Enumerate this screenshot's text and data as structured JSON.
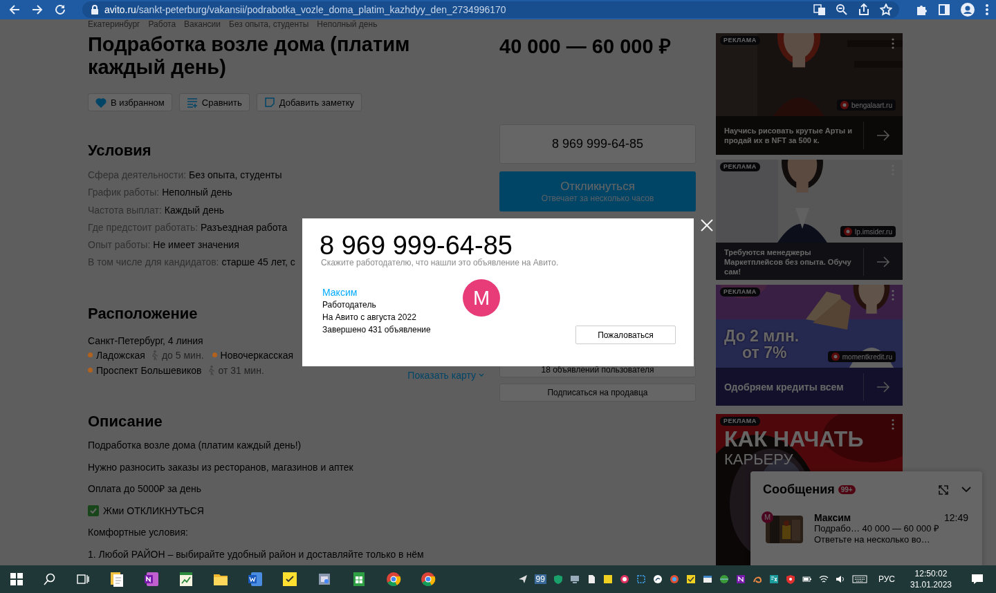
{
  "browser": {
    "url": "avito.ru/sankt-peterburg/vakansii/podrabotka_vozle_doma_platim_kazhdyy_den_2734996170"
  },
  "breadcrumbs": [
    "Екатеринбург",
    "Работа",
    "Вакансии",
    "Без опыта, студенты",
    "Неполный день"
  ],
  "title": "Подработка возле дома (платим каждый день)",
  "actions": [
    {
      "kind": "favorite",
      "label": "В избранном",
      "on": true
    },
    {
      "kind": "compare",
      "label": "Сравнить",
      "on": false
    },
    {
      "kind": "note",
      "label": "Добавить заметку",
      "on": false
    }
  ],
  "conditions": {
    "heading": "Условия",
    "rows": [
      {
        "label": "Сфера деятельности:",
        "value": "Без опыта, студенты"
      },
      {
        "label": "График работы:",
        "value": "Неполный день"
      },
      {
        "label": "Частота выплат:",
        "value": "Каждый день"
      },
      {
        "label": "Где предстоит работать:",
        "value": "Разъездная работа"
      },
      {
        "label": "Опыт работы:",
        "value": "Не имеет значения"
      },
      {
        "label": "В том числе для кандидатов:",
        "value": "старше 45 лет, с"
      }
    ]
  },
  "location": {
    "heading": "Расположение",
    "address": "Санкт-Петербург, 4 линия",
    "metro": [
      {
        "name": "Ладожская",
        "color": "#b0621e",
        "walk": "до 5 мин."
      },
      {
        "name": "Новочеркасская",
        "color": "#b0621e"
      },
      {
        "name": "Проспект Большевиков",
        "color": "#b0621e",
        "walk": "от 31 мин."
      }
    ],
    "map_link": "Показать карту"
  },
  "description": {
    "heading": "Описание",
    "paragraphs": [
      {
        "kind": "text",
        "text": "Подработка возле дома (платим каждый день!)"
      },
      {
        "kind": "text",
        "text": "Нужно разносить заказы из ресторанов, магазинов и аптек"
      },
      {
        "kind": "text",
        "text": "Оплата до 5000₽ за день"
      },
      {
        "kind": "check",
        "text": "Жми ОТКЛИКНУТЬСЯ"
      },
      {
        "kind": "text",
        "text": "Комфортные условия:"
      },
      {
        "kind": "text",
        "text": "1. Любой РАЙОН – выбирайте удобный район и доставляйте только в нём"
      }
    ]
  },
  "price": "40 000 — 60 000 ₽",
  "contact": {
    "phone": "8 969 999-64-85",
    "respond": "Откликнуться",
    "respond_hint": "Отвечает за несколько часов",
    "seller_ads": "18 объявлений пользователя",
    "subscribe": "Подписаться на продавца"
  },
  "ads": [
    {
      "label": "РЕКЛАМА",
      "domain": "bengalaart.ru",
      "caption": "Научись рисовать крутые Арты и продай их в NFT за 500 к."
    },
    {
      "label": "РЕКЛАМА",
      "domain": "lp.imsider.ru",
      "caption": "Требуются менеджеры Маркетплейсов без опыта. Обучу сам!"
    },
    {
      "label": "РЕКЛАМА",
      "domain": "momentkredit.ru",
      "caption": "Одобряем кредиты всем",
      "headline_lines": [
        {
          "kind": "bold",
          "text": "До 2 млн."
        },
        {
          "kind": "bold",
          "text": "от 7%"
        }
      ]
    },
    {
      "label": "РЕКЛАМА",
      "headline_lines": [
        {
          "kind": "large",
          "text": "КАК НАЧАТЬ"
        },
        {
          "kind": "small",
          "text": "КАРЬЕРУ"
        }
      ]
    }
  ],
  "messages": {
    "title": "Сообщения",
    "badge": "99+",
    "items": [
      {
        "avatar": "М",
        "name": "Максим",
        "time": "12:49",
        "preview": "Подрабо… 40 000 — 60 000 ₽",
        "subtitle": "Ответьте на несколько во…"
      }
    ]
  },
  "modal": {
    "phone": "8 969 999-64-85",
    "hint": "Скажите работодателю, что нашли это объявление на Авито.",
    "seller": {
      "name": "Максим",
      "role": "Работодатель",
      "since": "На Авито с августа 2022",
      "completed": "Завершено 431 объявление",
      "avatar": "М"
    },
    "report": "Пожаловаться"
  },
  "taskbar": {
    "tray_badge": "99",
    "language": "РУС",
    "time": "12:50:02",
    "date": "31.01.2023"
  }
}
